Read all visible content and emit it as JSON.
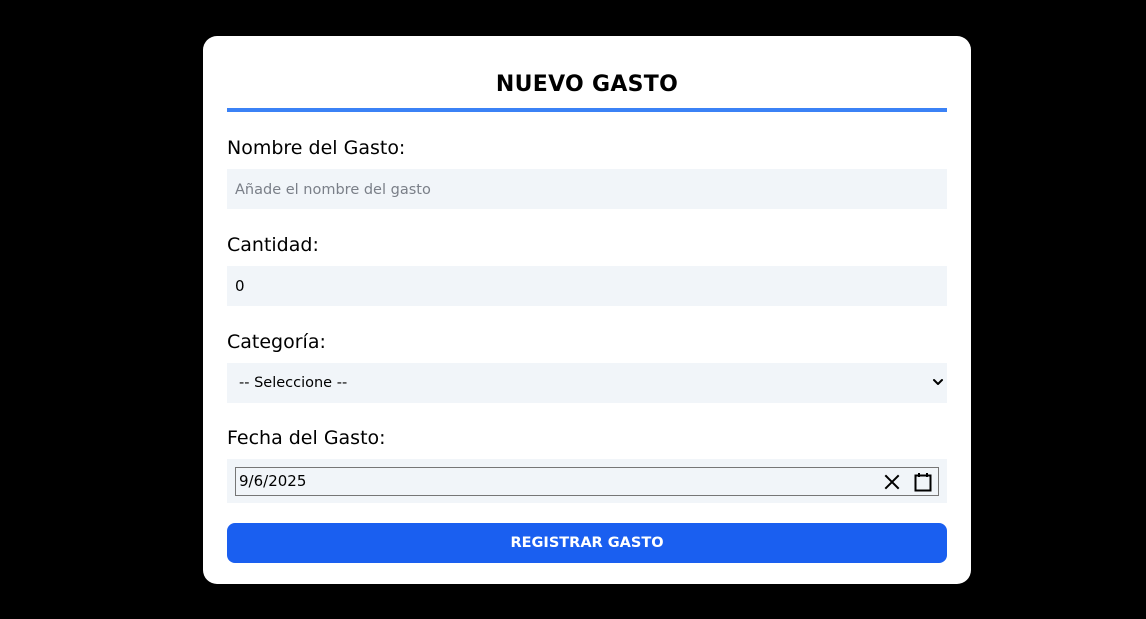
{
  "form": {
    "title": "NUEVO GASTO",
    "accent_color": "#3b82f6",
    "fields": {
      "nombre": {
        "label": "Nombre del Gasto:",
        "value": "",
        "placeholder": "Añade el nombre del gasto"
      },
      "cantidad": {
        "label": "Cantidad:",
        "value": "0"
      },
      "categoria": {
        "label": "Categoría:",
        "selected": "-- Seleccione --",
        "icon": "chevron-down-icon"
      },
      "fecha": {
        "label": "Fecha del Gasto:",
        "value": "9/6/2025",
        "clear_icon": "close-icon",
        "calendar_icon": "calendar-icon"
      }
    },
    "submit_label": "REGISTRAR GASTO",
    "submit_color": "#1a5ff0"
  }
}
